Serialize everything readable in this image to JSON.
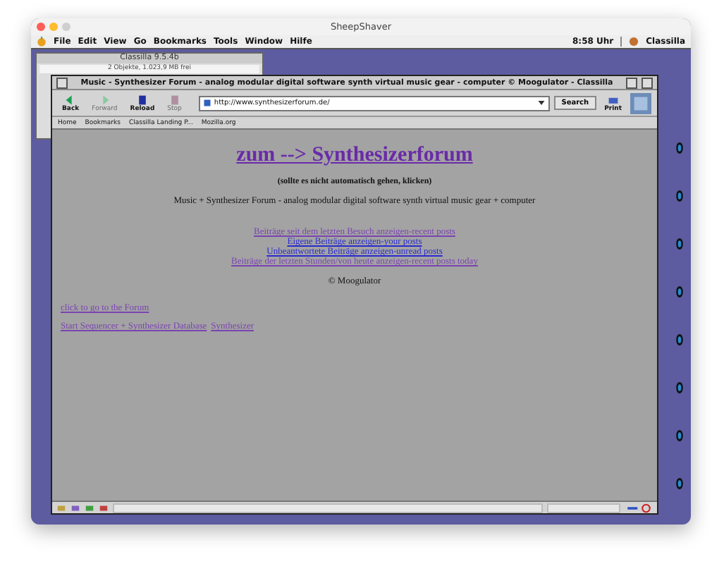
{
  "host_window": {
    "title": "SheepShaver"
  },
  "menu_bar": {
    "items": [
      "File",
      "Edit",
      "View",
      "Go",
      "Bookmarks",
      "Tools",
      "Window",
      "Hilfe"
    ],
    "clock": "8:58 Uhr",
    "app": "Classilla"
  },
  "finder_window": {
    "title": "Classilla 9.5.4b",
    "info": "2 Objekte, 1.023,9 MB frei"
  },
  "browser": {
    "title": "Music - Synthesizer Forum - analog modular digital software synth virtual music gear - computer © Moogulator - Classilla",
    "nav_buttons": [
      {
        "label": "Back",
        "disabled": false
      },
      {
        "label": "Forward",
        "disabled": true
      },
      {
        "label": "Reload",
        "disabled": false
      },
      {
        "label": "Stop",
        "disabled": true
      }
    ],
    "url": "http://www.synthesizerforum.de/",
    "search_button": "Search",
    "print_button": "Print",
    "bookmarks": [
      "Home",
      "Bookmarks",
      "Classilla Landing P...",
      "Mozilla.org"
    ]
  },
  "page": {
    "heading": "zum --> Synthesizerforum",
    "note": "(sollte es nicht automatisch gehen, klicken)",
    "description": "Music + Synthesizer Forum - analog modular digital software synth virtual music gear + computer",
    "links": [
      {
        "text": "Beiträge seit dem letzten Besuch anzeigen-recent posts",
        "visited": true
      },
      {
        "text": "Eigene Beiträge anzeigen-your posts",
        "visited": false
      },
      {
        "text": "Unbeantwortete Beiträge anzeigen-unread posts",
        "visited": false
      },
      {
        "text": "Beiträge der letzten Stunden/von heute anzeigen-recent posts today",
        "visited": true
      }
    ],
    "copyright": "© Moogulator",
    "left_links": [
      [
        {
          "text": "click to go to the Forum",
          "visited": true
        }
      ],
      [
        {
          "text": "Start Sequencer + Synthesizer Database",
          "visited": true
        },
        {
          "text": "Synthesizer",
          "visited": true
        }
      ]
    ]
  }
}
